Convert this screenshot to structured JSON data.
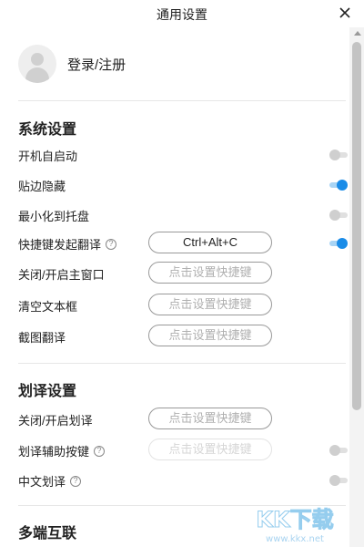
{
  "window": {
    "title": "通用设置"
  },
  "account": {
    "login_label": "登录/注册"
  },
  "system": {
    "title": "系统设置",
    "auto_start": {
      "label": "开机自启动",
      "enabled": false
    },
    "edge_hide": {
      "label": "贴边隐藏",
      "enabled": true
    },
    "minimize_tray": {
      "label": "最小化到托盘",
      "enabled": false
    },
    "shortcut_translate": {
      "label": "快捷键发起翻译",
      "shortcut": "Ctrl+Alt+C",
      "enabled": true
    },
    "toggle_main_window": {
      "label": "关闭/开启主窗口",
      "shortcut_placeholder": "点击设置快捷键"
    },
    "clear_textbox": {
      "label": "清空文本框",
      "shortcut_placeholder": "点击设置快捷键"
    },
    "screenshot_translate": {
      "label": "截图翻译",
      "shortcut_placeholder": "点击设置快捷键"
    }
  },
  "selection": {
    "title": "划译设置",
    "toggle_selection": {
      "label": "关闭/开启划译",
      "shortcut_placeholder": "点击设置快捷键"
    },
    "assist_key": {
      "label": "划译辅助按键",
      "shortcut_placeholder": "点击设置快捷键",
      "enabled": false
    },
    "chinese_selection": {
      "label": "中文划译",
      "enabled": false
    }
  },
  "multi_device": {
    "title": "多端互联"
  },
  "watermark": {
    "brand": "KK下载",
    "url": "www.kkx.net"
  },
  "colors": {
    "accent": "#1a8ce8",
    "divider": "#e6e6e6"
  }
}
